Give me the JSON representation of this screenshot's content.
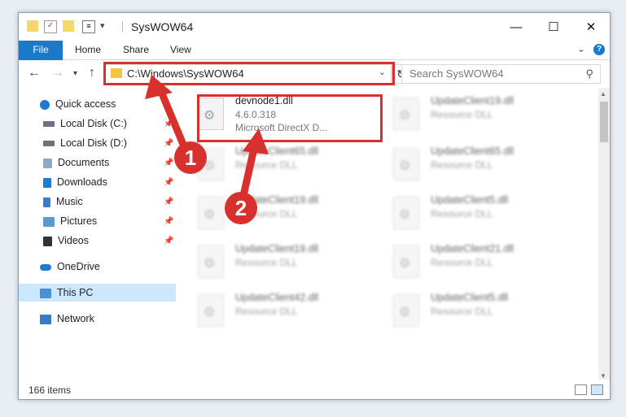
{
  "window": {
    "title": "SysWOW64",
    "controls": {
      "minimize": "—",
      "maximize": "☐",
      "close": "✕"
    }
  },
  "ribbon": {
    "tabs": [
      "File",
      "Home",
      "Share",
      "View"
    ],
    "help": "?"
  },
  "nav": {
    "address": "C:\\Windows\\SysWOW64",
    "search_placeholder": "Search SysWOW64"
  },
  "sidebar": {
    "items": [
      {
        "label": "Quick access",
        "icon": "star-icon",
        "color": "#1f7ad1"
      },
      {
        "label": "Local Disk (C:)",
        "icon": "drive-icon",
        "color": "#6b7280"
      },
      {
        "label": "Local Disk (D:)",
        "icon": "drive-icon",
        "color": "#6b7280"
      },
      {
        "label": "Documents",
        "icon": "documents-icon",
        "color": "#8fa8c8"
      },
      {
        "label": "Downloads",
        "icon": "download-icon",
        "color": "#1f7ad1"
      },
      {
        "label": "Music",
        "icon": "music-icon",
        "color": "#3d7cc9"
      },
      {
        "label": "Pictures",
        "icon": "pictures-icon",
        "color": "#5b9bd5"
      },
      {
        "label": "Videos",
        "icon": "videos-icon",
        "color": "#333333"
      },
      {
        "label": "OneDrive",
        "icon": "cloud-icon",
        "color": "#1f7ad1"
      },
      {
        "label": "This PC",
        "icon": "computer-icon",
        "color": "#4a90d9"
      },
      {
        "label": "Network",
        "icon": "network-icon",
        "color": "#3a7bc8"
      }
    ]
  },
  "files": [
    {
      "name": "devnode1.dll",
      "type": "4.6.0.318",
      "company": "Microsoft DirectX D..."
    },
    {
      "name": "UpdateClient19.dll",
      "type": "Resource DLL"
    },
    {
      "name": "UpdateClient65.dll",
      "type": "Resource DLL"
    },
    {
      "name": "UpdateClient65.dll",
      "type": "Resource DLL"
    },
    {
      "name": "UpdateClient19.dll",
      "type": "Resource DLL"
    },
    {
      "name": "UpdateClient5.dll",
      "type": "Resource DLL"
    },
    {
      "name": "UpdateClient19.dll",
      "type": "Resource DLL"
    },
    {
      "name": "UpdateClient21.dll",
      "type": "Resource DLL"
    },
    {
      "name": "UpdateClient42.dll",
      "type": "Resource DLL"
    },
    {
      "name": "UpdateClient5.dll",
      "type": "Resource DLL"
    }
  ],
  "status": {
    "count": "166 items"
  },
  "annotations": [
    "1",
    "2"
  ],
  "accent": "#d8302d"
}
